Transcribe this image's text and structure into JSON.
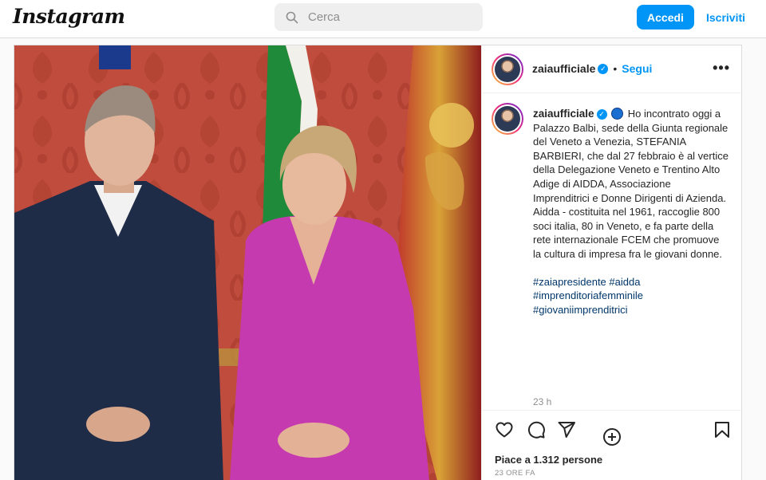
{
  "header": {
    "logo": "Instagram",
    "search_placeholder": "Cerca",
    "login_label": "Accedi",
    "signup_label": "Iscriviti"
  },
  "post": {
    "username": "zaiaufficiale",
    "follow_label": "Segui",
    "separator": "•",
    "more_label": "•••",
    "caption_lines": [
      "Ho incontrato oggi a Palazzo Balbi, sede della Giunta regionale del Veneto a Venezia, STEFANIA BARBIERI, che dal 27 febbraio è al vertice della Delegazione Veneto e Trentino Alto Adige di AIDDA, Associazione Imprenditrici e Donne Dirigenti di Azienda.",
      "Aidda - costituita nel 1961, raccoglie 800 soci italia, 80 in Veneto, e fa parte della rete internazionale FCEM che promuove la cultura di impresa fra le giovani donne."
    ],
    "hashtags": [
      "#zaiapresidente",
      "#aidda",
      "#imprenditoriafemminile",
      "#giovaniimprenditrici"
    ],
    "caption_time": "23 h",
    "likes": "Piace a 1.312 persone",
    "posted_ago": "23 ORE FA"
  },
  "icons": {
    "search": "search-icon",
    "verified": "verified-badge-icon",
    "more": "more-options-icon",
    "add_comment": "add-circle-icon",
    "like": "heart-icon",
    "comment": "comment-icon",
    "share": "share-icon",
    "save": "bookmark-icon"
  },
  "colors": {
    "accent": "#0095f6",
    "hashtag": "#00376b",
    "muted": "#8e8e8e"
  }
}
